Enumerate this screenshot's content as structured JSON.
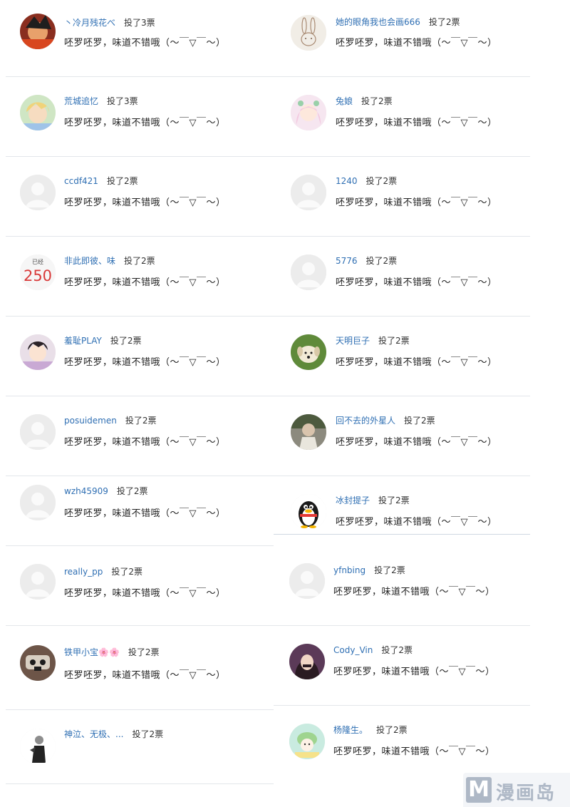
{
  "vote_label_prefix": "投了",
  "left": [
    {
      "user": "丶冷月残花べ",
      "votes": "投了3票",
      "comment": "呸罗呸罗，味道不错哦（～￣▽￣～）",
      "avatar": "avatar-anime-red"
    },
    {
      "user": "荒城追忆",
      "votes": "投了3票",
      "comment": "呸罗呸罗，味道不错哦（～￣▽￣～）",
      "avatar": "avatar-anime-blonde"
    },
    {
      "user": "ccdf421",
      "votes": "投了2票",
      "comment": "呸罗呸罗，味道不错哦（～￣▽￣～）",
      "avatar": "default-avatar"
    },
    {
      "user": "非此即彼、味",
      "votes": "投了2票",
      "comment": "呸罗呸罗，味道不错哦（～￣▽￣～）",
      "avatar": "avatar-text-250",
      "avatar_top": "已经",
      "avatar_num": "250"
    },
    {
      "user": "羞耻PLAY",
      "votes": "投了2票",
      "comment": "呸罗呸罗，味道不错哦（～￣▽￣～）",
      "avatar": "avatar-anime-boy"
    },
    {
      "user": "posuidemen",
      "votes": "投了2票",
      "comment": "呸罗呸罗，味道不错哦（～￣▽￣～）",
      "avatar": "default-avatar"
    },
    {
      "user": "wzh45909",
      "votes": "投了2票",
      "comment": "呸罗呸罗，味道不错哦（～￣▽￣～）",
      "avatar": "default-avatar"
    },
    {
      "user": "really_pp",
      "votes": "投了2票",
      "comment": "呸罗呸罗，味道不错哦（～￣▽￣～）",
      "avatar": "default-avatar"
    },
    {
      "user": "铁甲小宝🌸🌸",
      "votes": "投了2票",
      "comment": "呸罗呸罗，味道不错哦（～￣▽￣～）",
      "avatar": "avatar-mask"
    },
    {
      "user": "神泣、无极、...",
      "votes": "投了2票",
      "comment": "",
      "avatar": "avatar-dark-figure"
    }
  ],
  "right": [
    {
      "user": "她的眼角我也会画666",
      "votes": "投了2票",
      "comment": "呸罗呸罗，味道不错哦（～￣▽￣～）",
      "avatar": "avatar-bunny"
    },
    {
      "user": "兔娘",
      "votes": "投了2票",
      "comment": "呸罗呸罗，味道不错哦（～￣▽￣～）",
      "avatar": "avatar-anime-girl"
    },
    {
      "user": "1240",
      "votes": "投了2票",
      "comment": "呸罗呸罗，味道不错哦（～￣▽￣～）",
      "avatar": "default-avatar"
    },
    {
      "user": "5776",
      "votes": "投了2票",
      "comment": "呸罗呸罗，味道不错哦（～￣▽￣～）",
      "avatar": "default-avatar"
    },
    {
      "user": "天明巨子",
      "votes": "投了2票",
      "comment": "呸罗呸罗，味道不错哦（～￣▽￣～）",
      "avatar": "avatar-puppy"
    },
    {
      "user": "回不去的外星人",
      "votes": "投了2票",
      "comment": "呸罗呸罗，味道不错哦（～￣▽￣～）",
      "avatar": "avatar-photo-man"
    },
    {
      "user": "冰封提子",
      "votes": "投了2票",
      "comment": "呸罗呸罗，味道不错哦（～￣▽￣～）",
      "avatar": "avatar-penguin"
    },
    {
      "user": "yfnbing",
      "votes": "投了2票",
      "comment": "呸罗呸罗，味道不错哦（～￣▽￣～）",
      "avatar": "default-avatar"
    },
    {
      "user": "Cody_Vin",
      "votes": "投了2票",
      "comment": "呸罗呸罗，味道不错哦（～￣▽￣～）",
      "avatar": "avatar-photo-girl"
    },
    {
      "user": "杨隆生。",
      "votes": "投了2票",
      "comment": "呸罗呸罗，味道不错哦（～￣▽￣～）",
      "avatar": "avatar-cartoon-green"
    }
  ],
  "watermark": {
    "letter": "M",
    "text": "漫画岛"
  }
}
